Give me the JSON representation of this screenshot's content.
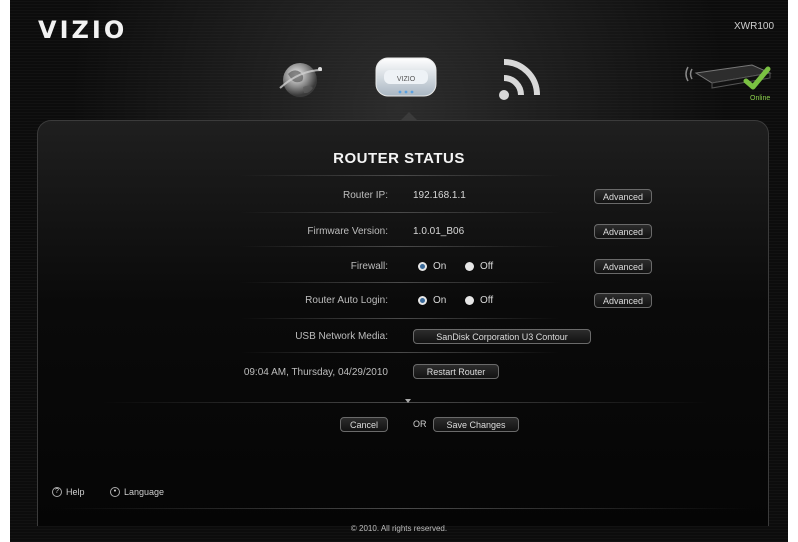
{
  "header": {
    "brand": "VIZIO",
    "model": "XWR100",
    "status_label": "Online",
    "router_icon_label": "VIZIO"
  },
  "nav": {
    "items": [
      {
        "name": "internet",
        "icon": "globe-icon"
      },
      {
        "name": "router",
        "icon": "router-icon",
        "selected": true
      },
      {
        "name": "wireless",
        "icon": "wifi-icon"
      }
    ]
  },
  "router_status": {
    "title": "ROUTER STATUS",
    "router_ip": {
      "label": "Router IP:",
      "value": "192.168.1.1",
      "button": "Advanced"
    },
    "firmware": {
      "label": "Firmware Version:",
      "value": "1.0.01_B06",
      "button": "Advanced"
    },
    "firewall": {
      "label": "Firewall:",
      "on": "On",
      "off": "Off",
      "selected": "On",
      "button": "Advanced"
    },
    "auto_login": {
      "label": "Router Auto Login:",
      "on": "On",
      "off": "Off",
      "selected": "On",
      "button": "Advanced"
    },
    "usb_media": {
      "label": "USB Network Media:",
      "button": "SanDisk Corporation U3 Contour"
    },
    "datetime": {
      "label": "09:04 AM, Thursday, 04/29/2010",
      "button": "Restart Router"
    }
  },
  "actions": {
    "cancel": "Cancel",
    "or": "OR",
    "save": "Save Changes"
  },
  "footer": {
    "help": "Help",
    "language": "Language",
    "copyright": "© 2010. All rights reserved."
  },
  "colors": {
    "background": "#0c0c0c",
    "online_green": "#8bd04b",
    "check_green": "#7ac142"
  }
}
